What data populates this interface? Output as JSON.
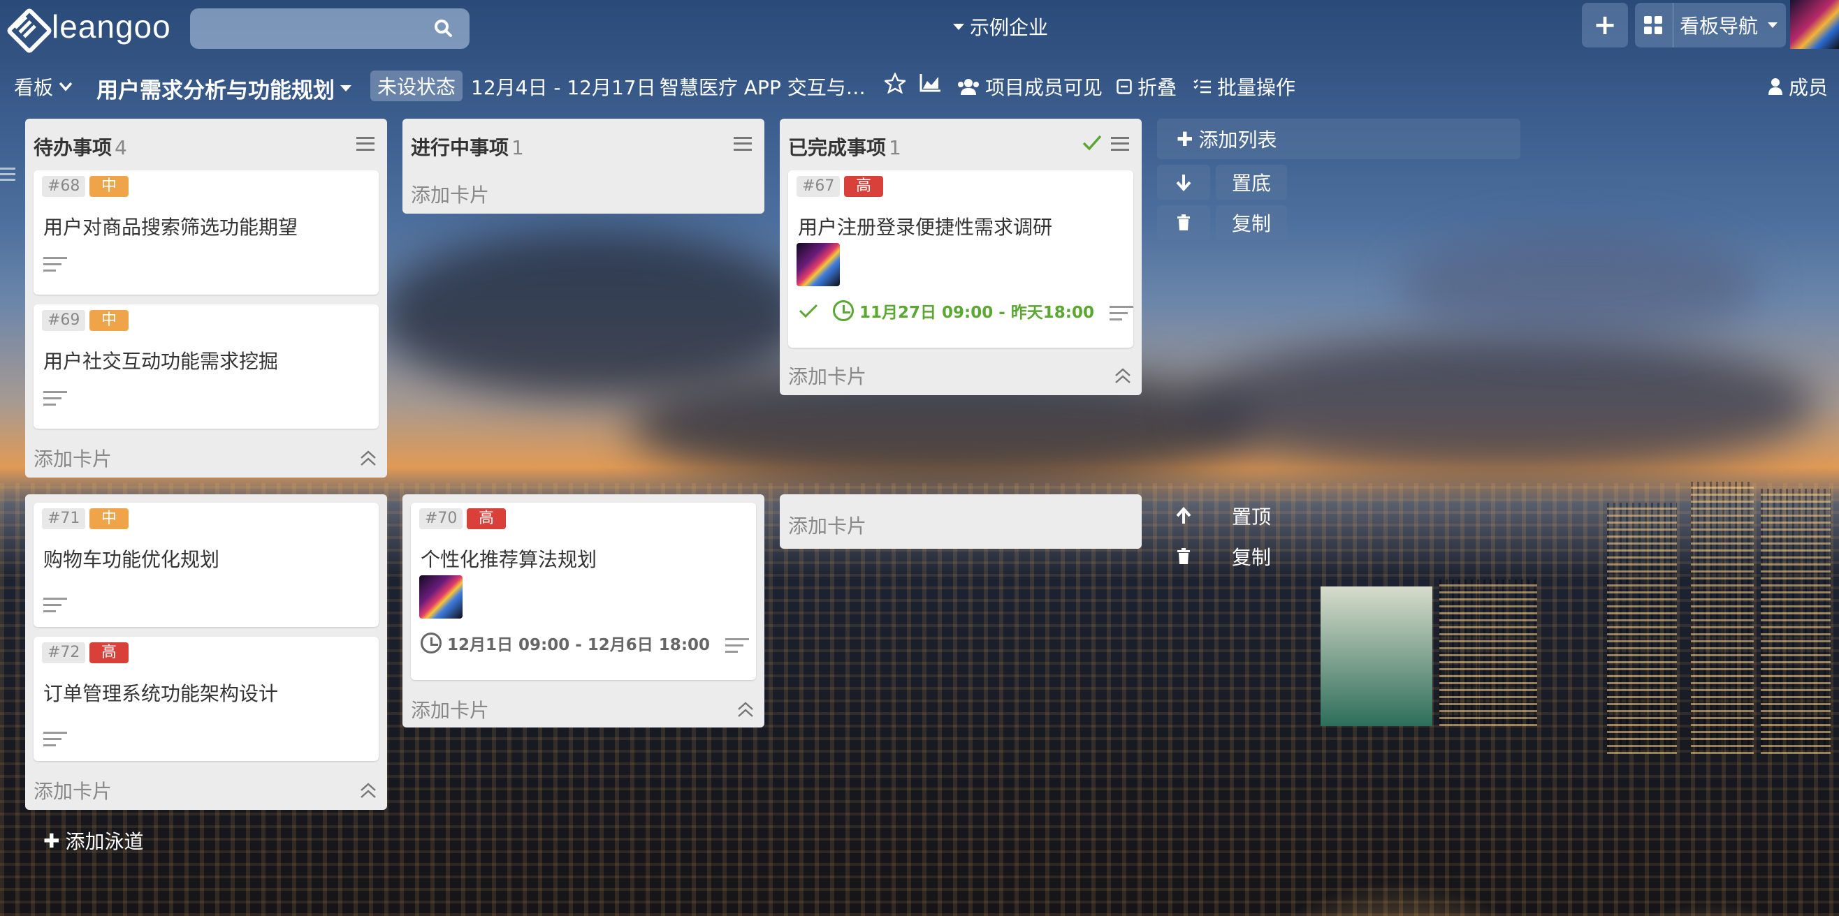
{
  "app": {
    "logo_text": "leangoo",
    "org_name": "示例企业",
    "board_nav_label": "看板导航"
  },
  "search": {
    "placeholder": ""
  },
  "board": {
    "view_label": "看板",
    "title": "用户需求分析与功能规划",
    "state_badge": "未设状态",
    "date_range": "12月4日 - 12月17日",
    "project": "智慧医疗 APP 交互与…",
    "visibility": "项目成员可见",
    "fold_label": "折叠",
    "batch_label": "批量操作",
    "members_label": "成员"
  },
  "lists": [
    {
      "name": "待办事项",
      "count": "4"
    },
    {
      "name": "进行中事项",
      "count": "1"
    },
    {
      "name": "已完成事项",
      "count": "1"
    }
  ],
  "cards": {
    "c68": {
      "num": "#68",
      "priority": "中",
      "title": "用户对商品搜索筛选功能期望"
    },
    "c69": {
      "num": "#69",
      "priority": "中",
      "title": "用户社交互动功能需求挖掘"
    },
    "c67": {
      "num": "#67",
      "priority": "高",
      "title": "用户注册登录便捷性需求调研",
      "due": "11月27日 09:00 - 昨天18:00"
    },
    "c71": {
      "num": "#71",
      "priority": "中",
      "title": "购物车功能优化规划"
    },
    "c72": {
      "num": "#72",
      "priority": "高",
      "title": "订单管理系统功能架构设计"
    },
    "c70": {
      "num": "#70",
      "priority": "高",
      "title": "个性化推荐算法规划",
      "due": "12月1日 09:00 - 12月6日 18:00"
    }
  },
  "add_card_label": "添加卡片",
  "actions": {
    "add_list": "添加列表",
    "to_bottom": "置底",
    "copy": "复制",
    "to_top": "置顶",
    "add_swimlane": "添加泳道"
  },
  "colors": {
    "priority_mid": "#f0a44a",
    "priority_high": "#d9403a",
    "done_green": "#5aa832",
    "list_bg": "#ececec"
  }
}
